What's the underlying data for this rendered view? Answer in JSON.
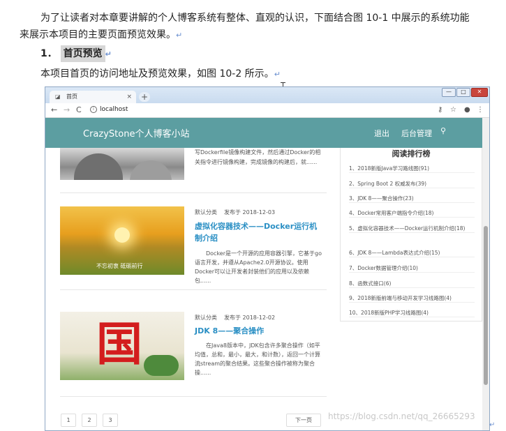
{
  "document": {
    "paragraph1_line1": "为了让读者对本章要讲解的个人博客系统有整体、直观的认识，下面结合图 10-1 中展示的系统功能",
    "paragraph1_line2": "来展示本项目的主要页面预览效果。",
    "heading_number": "1．",
    "heading_text": "首页预览",
    "paragraph2": "本项目首页的访问地址及预览效果，如图 10-2 所示。",
    "paragraph_mark": "↵",
    "watermark": "https://blog.csdn.net/qq_26665293"
  },
  "browser": {
    "tab_title": "首页",
    "tab_close": "×",
    "new_tab": "+",
    "window_buttons": [
      "—",
      "□",
      "✕"
    ],
    "url": "localhost",
    "nav": {
      "back": "←",
      "forward": "→",
      "reload": "C"
    }
  },
  "site": {
    "brand": "CrazyStone个人博客小站",
    "nav_logout": "退出",
    "nav_admin": "后台管理",
    "search_icon": "magnifier"
  },
  "posts": {
    "top_snippet": "写Dockerfile镜像构建文件，然后通过Docker的相关指令进行镜像构建，完成镜像的构建后，就......",
    "items": [
      {
        "category": "默认分类",
        "published": "发布于 2018-12-03",
        "title": "虚拟化容器技术——Docker运行机制介绍",
        "excerpt": "Docker是一个开源的应用容器引擎，它基于go语言开发，并遵从Apache2.0开源协议。使用Docker可以让开发者封装他们的应用以及依赖包......",
        "image_caption": "不忘初衷 砥砺前行"
      },
      {
        "category": "默认分类",
        "published": "发布于 2018-12-02",
        "title": "JDK 8——聚合操作",
        "excerpt": "在Java8版本中，JDK包含许多聚合操作（如平均值，总和，最小，最大，和计数），返回一个计算流stream的聚合结果。这些聚合操作被称为聚合操......",
        "image_char": "国"
      }
    ]
  },
  "sidebar": {
    "title": "阅读排行榜",
    "items": [
      "1、2018新版Java学习路线图(91)",
      "2、Spring Boot 2 权威发布(39)",
      "3、JDK 8——聚合操作(23)",
      "4、Docker常用客户端指令介绍(18)",
      "5、虚拟化容器技术——Docker运行机制介绍(18)",
      "6、JDK 8——Lambda表达式介绍(15)",
      "7、Docker数据管理介绍(10)",
      "8、函数式接口(6)",
      "9、2018新版前端与移动开发学习线路图(4)",
      "10、2018新版PHP学习线路图(4)"
    ]
  },
  "pagination": {
    "pages": [
      "1",
      "2",
      "3"
    ],
    "next": "下一页"
  }
}
